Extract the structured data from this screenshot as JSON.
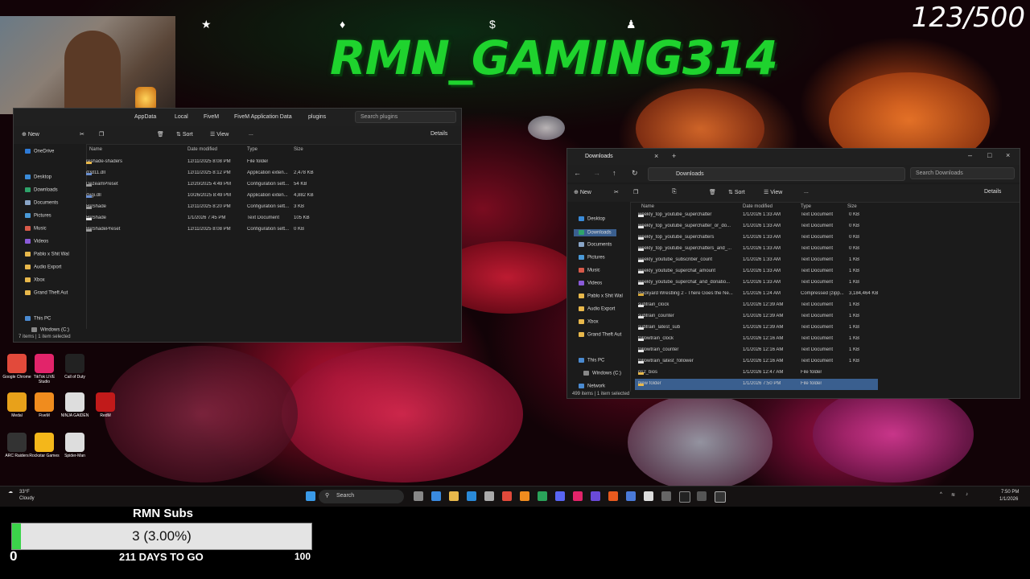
{
  "overlay": {
    "channel_name": "RMN_GAMING314",
    "counter": "123/500"
  },
  "left_explorer": {
    "breadcrumbs": [
      "AppData",
      "Local",
      "FiveM",
      "FiveM Application Data",
      "plugins"
    ],
    "search_placeholder": "Search plugins",
    "toolbar": {
      "new": "New",
      "sort": "Sort",
      "view": "View",
      "more": "...",
      "details": "Details"
    },
    "nav": [
      "OneDrive",
      "Desktop",
      "Downloads",
      "Documents",
      "Pictures",
      "Music",
      "Videos",
      "Pablo x Shit Wal",
      "Audio Export",
      "Xbox",
      "Grand Theft Aut",
      "This PC",
      "Windows (C:)"
    ],
    "columns": [
      "Name",
      "Date modified",
      "Type",
      "Size"
    ],
    "rows": [
      {
        "name": "reshade-shaders",
        "date": "12/11/2025 8:08 PM",
        "type": "File folder",
        "size": "",
        "icon": "folder"
      },
      {
        "name": "d3d11.dll",
        "date": "12/11/2025 8:12 PM",
        "type": "Application exten...",
        "size": "2,478 KB",
        "icon": "app"
      },
      {
        "name": "DezeamPreset",
        "date": "12/20/2025 4:49 PM",
        "type": "Configuration sett...",
        "size": "54 KB",
        "icon": "cfg"
      },
      {
        "name": "dxgi.dll",
        "date": "10/26/2025 8:49 PM",
        "type": "Application exten...",
        "size": "4,882 KB",
        "icon": "app"
      },
      {
        "name": "ReShade",
        "date": "12/11/2025 8:20 PM",
        "type": "Configuration sett...",
        "size": "3 KB",
        "icon": "cfg"
      },
      {
        "name": "ReShade",
        "date": "1/1/2026 7:45 PM",
        "type": "Text Document",
        "size": "105 KB",
        "icon": "doc"
      },
      {
        "name": "ReShadePreset",
        "date": "12/11/2025 8:08 PM",
        "type": "Configuration sett...",
        "size": "0 KB",
        "icon": "cfg"
      }
    ],
    "status": "7 items  |  1 item selected"
  },
  "right_explorer": {
    "tab_title": "Downloads",
    "breadcrumb": "Downloads",
    "search_placeholder": "Search Downloads",
    "toolbar": {
      "new": "New",
      "sort": "Sort",
      "view": "View",
      "more": "...",
      "details": "Details"
    },
    "nav": [
      "Desktop",
      "Downloads",
      "Documents",
      "Pictures",
      "Music",
      "Videos",
      "Pablo x Shit Wal",
      "Audio Export",
      "Xbox",
      "Grand Theft Aut",
      "This PC",
      "Windows (C:)",
      "Network"
    ],
    "columns": [
      "Name",
      "Date modified",
      "Type",
      "Size"
    ],
    "rows": [
      {
        "name": "weekly_top_youtube_superchatter",
        "date": "1/1/2026 1:33 AM",
        "type": "Text Document",
        "size": "0 KB",
        "icon": "doc"
      },
      {
        "name": "weekly_top_youtube_superchatter_or_do...",
        "date": "1/1/2026 1:33 AM",
        "type": "Text Document",
        "size": "0 KB",
        "icon": "doc"
      },
      {
        "name": "weekly_top_youtube_superchatters",
        "date": "1/1/2026 1:33 AM",
        "type": "Text Document",
        "size": "0 KB",
        "icon": "doc"
      },
      {
        "name": "weekly_top_youtube_superchatters_and_...",
        "date": "1/1/2026 1:33 AM",
        "type": "Text Document",
        "size": "0 KB",
        "icon": "doc"
      },
      {
        "name": "weekly_youtube_subscriber_count",
        "date": "1/1/2026 1:33 AM",
        "type": "Text Document",
        "size": "1 KB",
        "icon": "doc"
      },
      {
        "name": "weekly_youtube_superchat_amount",
        "date": "1/1/2026 1:33 AM",
        "type": "Text Document",
        "size": "1 KB",
        "icon": "doc"
      },
      {
        "name": "weekly_youtube_superchat_and_donatio...",
        "date": "1/1/2026 1:33 AM",
        "type": "Text Document",
        "size": "1 KB",
        "icon": "doc"
      },
      {
        "name": "Backyard Wrestling 2 - There Goes the Ne...",
        "date": "1/1/2026 1:24 AM",
        "type": "Compressed (zipp...",
        "size": "3,184,464 KB",
        "icon": "zip"
      },
      {
        "name": "subtrain_clock",
        "date": "1/1/2026 12:39 AM",
        "type": "Text Document",
        "size": "1 KB",
        "icon": "doc"
      },
      {
        "name": "subtrain_counter",
        "date": "1/1/2026 12:39 AM",
        "type": "Text Document",
        "size": "1 KB",
        "icon": "doc"
      },
      {
        "name": "subtrain_latest_sub",
        "date": "1/1/2026 12:39 AM",
        "type": "Text Document",
        "size": "1 KB",
        "icon": "doc"
      },
      {
        "name": "followtrain_clock",
        "date": "1/1/2026 12:16 AM",
        "type": "Text Document",
        "size": "1 KB",
        "icon": "doc"
      },
      {
        "name": "followtrain_counter",
        "date": "1/1/2026 12:16 AM",
        "type": "Text Document",
        "size": "1 KB",
        "icon": "doc"
      },
      {
        "name": "followtrain_latest_follower",
        "date": "1/1/2026 12:16 AM",
        "type": "Text Document",
        "size": "1 KB",
        "icon": "doc"
      },
      {
        "name": "ps2_bios",
        "date": "1/1/2026 12:47 AM",
        "type": "File folder",
        "size": "",
        "icon": "folder"
      },
      {
        "name": "New folder",
        "date": "1/1/2026 7:50 PM",
        "type": "File folder",
        "size": "",
        "icon": "folder"
      }
    ],
    "status": "499 items  |  1 item selected"
  },
  "desktop_icons": [
    {
      "label": "Google Chrome",
      "color": "#e24a3b"
    },
    {
      "label": "TikTok LIVE Studio",
      "color": "#e2246a"
    },
    {
      "label": "Call of Duty",
      "color": "#222222"
    },
    {
      "label": "Medal",
      "color": "#e8a11a"
    },
    {
      "label": "FiveM",
      "color": "#f08c1e"
    },
    {
      "label": "NINJA GAIDEN",
      "color": "#dddddd"
    },
    {
      "label": "RedM",
      "color": "#c11a1a"
    },
    {
      "label": "ARC Raiders",
      "color": "#333333"
    },
    {
      "label": "Rockstar Games",
      "color": "#f4b71a"
    },
    {
      "label": "Spider-Man",
      "color": "#dddddd"
    }
  ],
  "taskbar": {
    "weather_temp": "33°F",
    "weather_desc": "Cloudy",
    "search_label": "Search",
    "time": "7:50 PM",
    "date": "1/1/2026"
  },
  "subs_goal": {
    "title": "RMN Subs",
    "value_label": "3 (3.00%)",
    "progress_fraction": 0.03,
    "min": "0",
    "max": "100",
    "days_label": "211 DAYS TO GO",
    "accent": "#3bd44a"
  }
}
